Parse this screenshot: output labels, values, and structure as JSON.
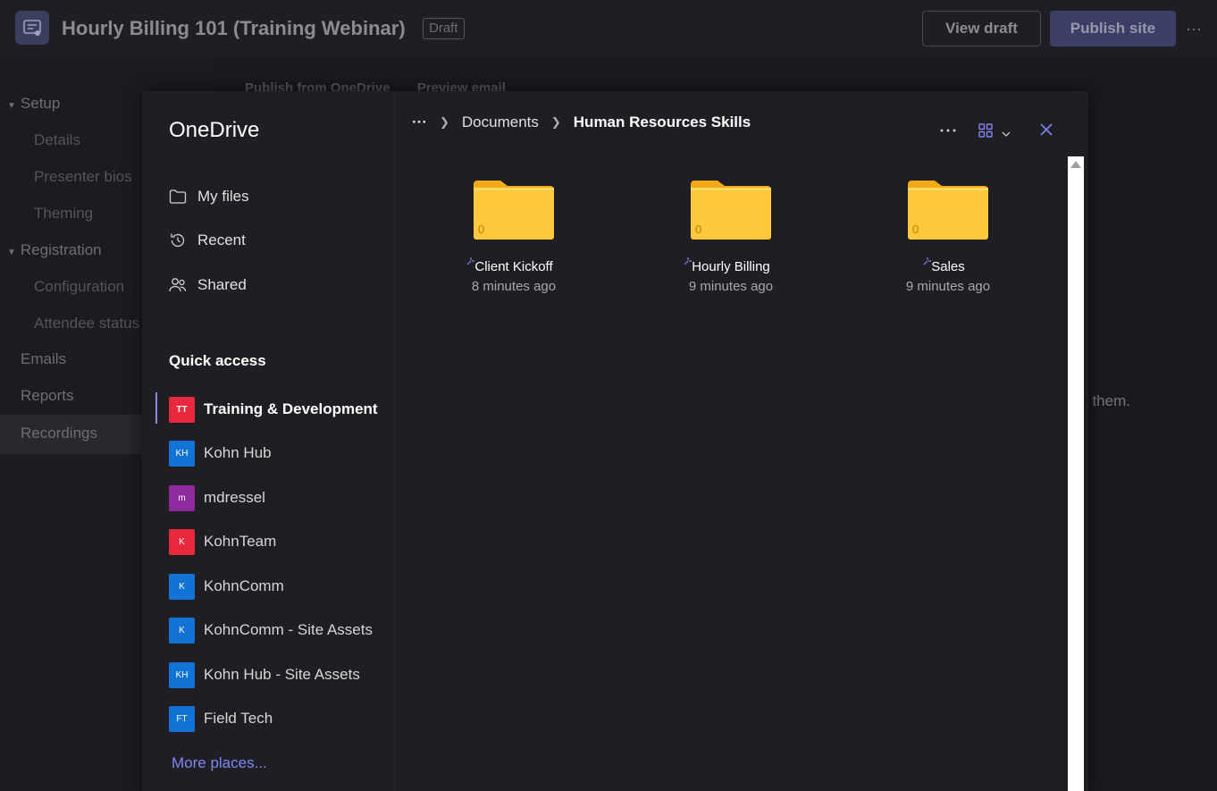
{
  "header": {
    "title": "Hourly Billing 101 (Training Webinar)",
    "draft_badge": "Draft",
    "view_draft": "View draft",
    "publish_site": "Publish site",
    "more": "···"
  },
  "leftnav": {
    "setup": "Setup",
    "details": "Details",
    "presenter_bios": "Presenter bios",
    "theming": "Theming",
    "registration": "Registration",
    "configuration": "Configuration",
    "attendee_status": "Attendee status",
    "emails": "Emails",
    "reports": "Reports",
    "recordings": "Recordings"
  },
  "background": {
    "publish_from_onedrive": "Publish from OneDrive",
    "preview_email": "Preview email",
    "trailing_text": "ish them."
  },
  "onedrive": {
    "title": "OneDrive",
    "nav": [
      {
        "label": "My files",
        "icon": "folder-icon"
      },
      {
        "label": "Recent",
        "icon": "history-icon"
      },
      {
        "label": "Shared",
        "icon": "people-icon"
      }
    ],
    "quick_access_heading": "Quick access",
    "quick_access": [
      {
        "initials": "TT",
        "label": "Training & Development",
        "color": "#e8283c",
        "selected": true
      },
      {
        "initials": "KH",
        "label": "Kohn Hub",
        "color": "#1272d6"
      },
      {
        "initials": "m",
        "label": "mdressel",
        "color": "#8e2a9e"
      },
      {
        "initials": "K",
        "label": "KohnTeam",
        "color": "#e8283c"
      },
      {
        "initials": "K",
        "label": "KohnComm",
        "color": "#1272d6"
      },
      {
        "initials": "K",
        "label": "KohnComm - Site Assets",
        "color": "#1272d6"
      },
      {
        "initials": "KH",
        "label": "Kohn Hub - Site Assets",
        "color": "#1272d6"
      },
      {
        "initials": "FT",
        "label": "Field Tech",
        "color": "#1272d6"
      }
    ],
    "more_places": "More places...",
    "breadcrumb": {
      "ellipsis": "···",
      "parent": "Documents",
      "current": "Human Resources Skills"
    },
    "folders": [
      {
        "name": "Client Kickoff",
        "modified": "8 minutes ago",
        "count": "0"
      },
      {
        "name": "Hourly Billing",
        "modified": "9 minutes ago",
        "count": "0"
      },
      {
        "name": "Sales",
        "modified": "9 minutes ago",
        "count": "0"
      }
    ],
    "colors": {
      "accent": "#7f85f5",
      "folder": "#ffc83d",
      "folder_tab": "#f4a917"
    }
  }
}
